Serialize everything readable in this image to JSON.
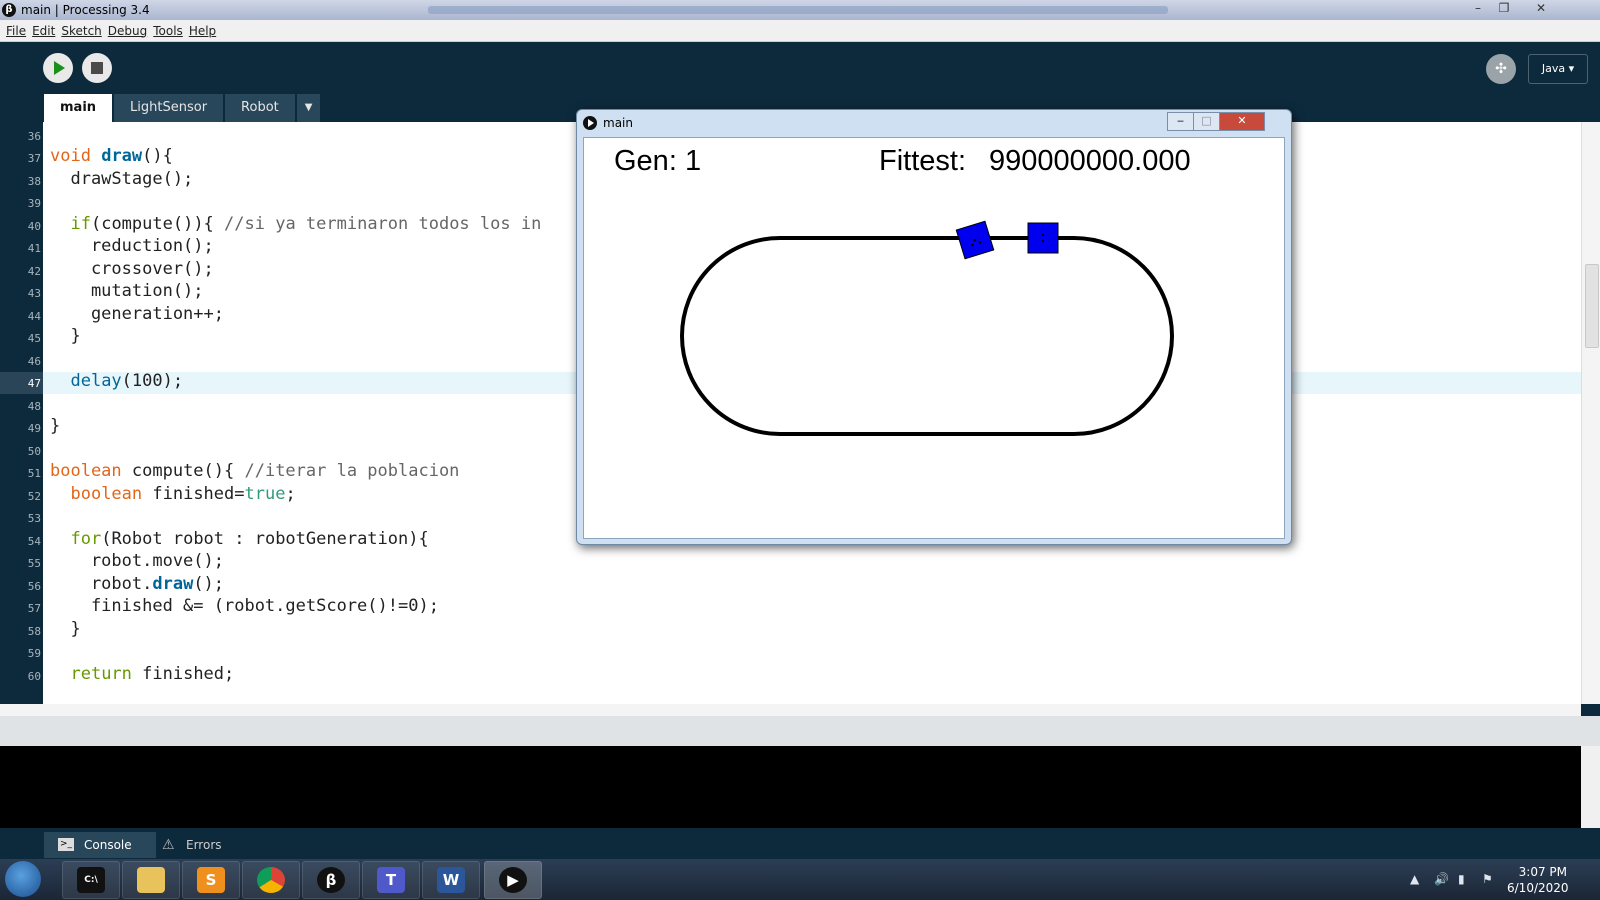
{
  "window": {
    "title": "main | Processing 3.4",
    "app_icon": "processing-logo-icon",
    "minimize": "–",
    "maximize": "❐",
    "close": "✕"
  },
  "menu": [
    "File",
    "Edit",
    "Sketch",
    "Debug",
    "Tools",
    "Help"
  ],
  "toolbar": {
    "run_icon": "play-icon",
    "stop_icon": "stop-icon",
    "debug_icon": "debugger-icon",
    "mode_label": "Java ▾"
  },
  "tabs": {
    "items": [
      "main",
      "LightSensor",
      "Robot"
    ],
    "active": "main",
    "more": "▼"
  },
  "editor": {
    "current_line": "47",
    "line_numbers": [
      "36",
      "37",
      "38",
      "39",
      "40",
      "41",
      "42",
      "43",
      "44",
      "45",
      "46",
      "47",
      "48",
      "49",
      "50",
      "51",
      "52",
      "53",
      "54",
      "55",
      "56",
      "57",
      "58",
      "59",
      "60"
    ]
  },
  "footer_tabs": {
    "console": "Console",
    "errors": "Errors"
  },
  "sketch": {
    "title": "main",
    "gen_label": "Gen:",
    "gen_value": "1",
    "fittest_label": "Fittest:",
    "fittest_value": "990000000.000",
    "track_color": "#000000",
    "robot_color": "#0000ee"
  },
  "taskbar": {
    "apps": [
      "cmd-icon",
      "file-explorer-icon",
      "sublime-text-icon",
      "chrome-icon",
      "processing-icon",
      "teams-icon",
      "word-icon",
      "sketch-window-icon"
    ],
    "time": "3:07 PM",
    "date": "6/10/2020"
  }
}
